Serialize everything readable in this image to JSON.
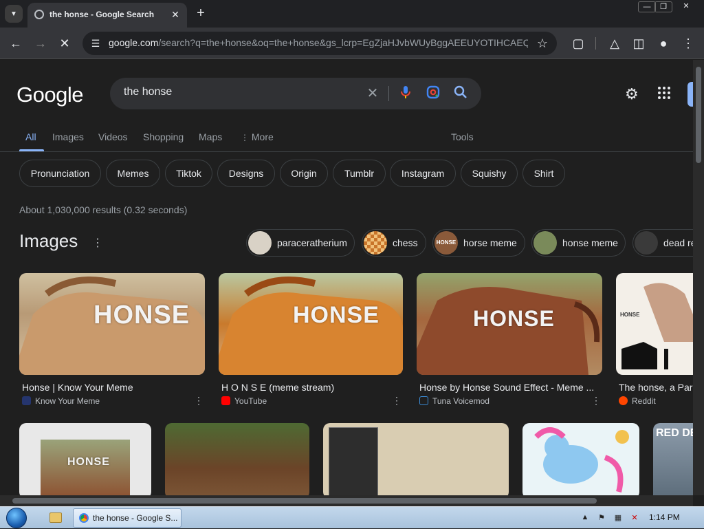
{
  "browser": {
    "tab_title": "the honse - Google Search",
    "new_tab_label": "+",
    "close_tab_label": "✕",
    "url_host": "google.com",
    "url_path": "/search?q=the+honse&oq=the+honse&gs_lcrp=EgZjaHJvbWUyBggAEEUYOTIHCAEQ..."
  },
  "google": {
    "logo": "Google",
    "query": "the honse",
    "nav": {
      "all": "All",
      "images": "Images",
      "videos": "Videos",
      "shopping": "Shopping",
      "maps": "Maps",
      "more": "More",
      "tools": "Tools"
    },
    "chips": [
      "Pronunciation",
      "Memes",
      "Tiktok",
      "Designs",
      "Origin",
      "Tumblr",
      "Instagram",
      "Squishy",
      "Shirt"
    ],
    "stats": "About 1,030,000 results (0.32 seconds)",
    "images_heading": "Images",
    "image_chips": [
      "paraceratherium",
      "chess",
      "horse meme",
      "honse meme",
      "dead re"
    ],
    "thumb_texts": {
      "honse": "HONSE",
      "honse_chip": "HONSE",
      "diagram": "HONSE",
      "red_dead": "RED DE"
    },
    "cards": [
      {
        "title": "Honse | Know Your Meme",
        "source": "Know Your Meme"
      },
      {
        "title": "H O N S E (meme stream)",
        "source": "YouTube"
      },
      {
        "title": "Honse by Honse Sound Effect - Meme ...",
        "source": "Tuna Voicemod"
      },
      {
        "title": "The honse, a Par",
        "source": "Reddit"
      }
    ]
  },
  "taskbar": {
    "task_label": "the honse - Google S...",
    "clock": "1:14 PM"
  }
}
